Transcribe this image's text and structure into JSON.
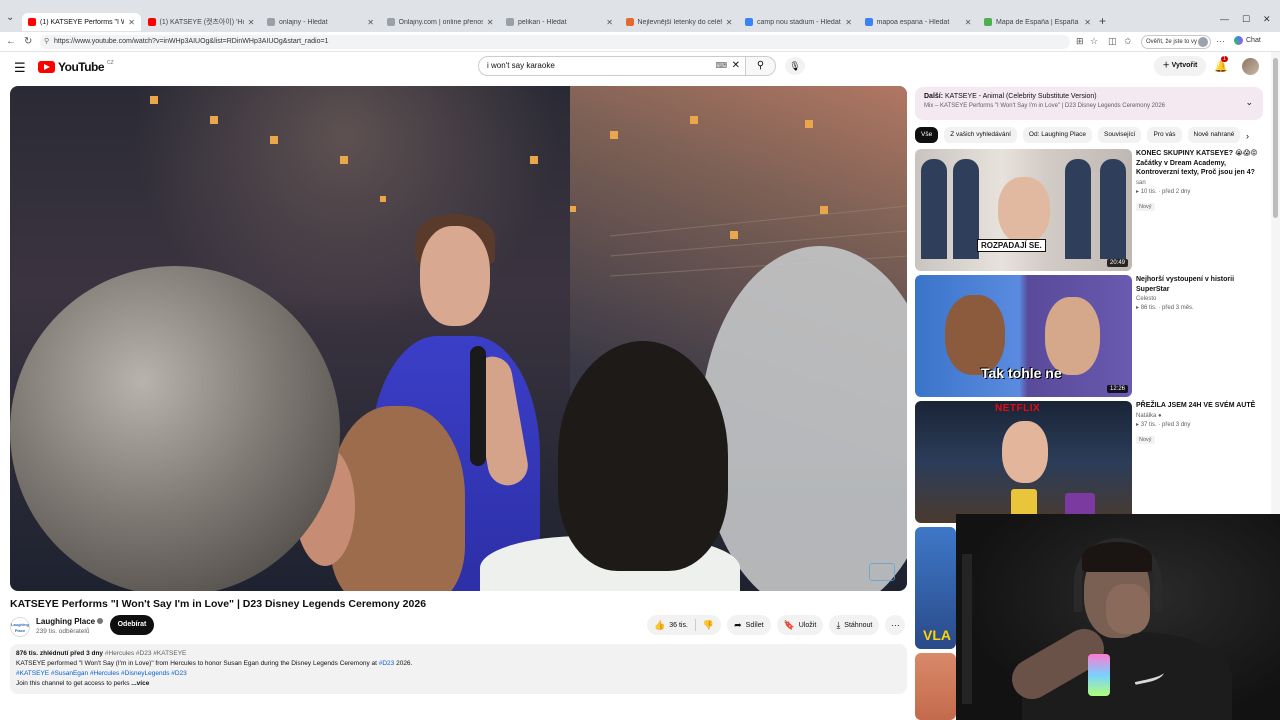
{
  "browser": {
    "tabs": [
      {
        "title": "(1) KATSEYE Performs \"I Won't",
        "favicon_color": "#ff0000",
        "active": true
      },
      {
        "title": "(1) KATSEYE (캣츠아이) 'Hootie Fri",
        "favicon_color": "#ff0000",
        "active": false
      },
      {
        "title": "onlajny - Hledat",
        "favicon_color": "#9aa0a6",
        "active": false
      },
      {
        "title": "Onlajny.com | online přenosy spo",
        "favicon_color": "#9aa0a6",
        "active": false
      },
      {
        "title": "pelikan - Hledat",
        "favicon_color": "#9aa0a6",
        "active": false
      },
      {
        "title": "Nejlevnější letenky do celého svět",
        "favicon_color": "#e36a2c",
        "active": false
      },
      {
        "title": "camp nou stadium - Hledat",
        "favicon_color": "#3b82f6",
        "active": false
      },
      {
        "title": "mapoa espana - Hledat",
        "favicon_color": "#3b82f6",
        "active": false
      },
      {
        "title": "Mapa de España | España Mapas",
        "favicon_color": "#4caf50",
        "active": false
      }
    ],
    "url": "https://www.youtube.com/watch?v=inWHp3AIUOg&list=RDinWHp3AIUOg&start_radio=1",
    "verify_label": "Ověřit, že jste to vy",
    "chat_label": "Chat"
  },
  "header": {
    "logo_text": "YouTube",
    "logo_country": "CZ",
    "search_value": "i won't say karaoke",
    "create_label": "Vytvořit",
    "notifications": "1"
  },
  "video": {
    "title": "KATSEYE Performs \"I Won't Say I'm in Love\" | D23 Disney Legends Ceremony 2026",
    "channel": {
      "name": "Laughing Place",
      "subscribers": "239 tis. odběratelů",
      "avatar_text": "Laughing Place",
      "subscribe_label": "Odebírat"
    },
    "actions": {
      "likes": "36 tis.",
      "share": "Sdílet",
      "save": "Uložit",
      "download": "Stáhnout"
    },
    "description": {
      "views_date": "876 tis. zhlédnutí  před 3 dny",
      "hashtags_top": "#Hercules #D23 #KATSEYE",
      "line1_pre": "KATSEYE performed \"I Won't Say (I'm in Love)\" from Hercules to honor Susan Egan during the Disney Legends Ceremony at ",
      "line1_tag": "#D23",
      "line1_post": " 2026.",
      "line2_tags": "#KATSEYE #SusanEgan #Hercules #DisneyLegends #D23",
      "line3": "Join this channel to get access to perks",
      "more_label": "...více"
    }
  },
  "sidebar": {
    "mix": {
      "next_label": "Další:",
      "next_title": "KATSEYE - Animal (Celebrity Substitute Version)",
      "subtitle": "Mix – KATSEYE Performs \"I Won't Say I'm in Love\" | D23 Disney Legends Ceremony 2026"
    },
    "chips": [
      "Vše",
      "Z vašich vyhledávání",
      "Od: Laughing Place",
      "Související",
      "Pro vás",
      "Nově nahrané"
    ],
    "recommendations": [
      {
        "title": "KONEC SKUPINY KATSEYE? 😭😱😡 Začátky v Dream Academy, Kontroverzní texty, Proč jsou jen 4?",
        "channel": "san",
        "meta": "10 tis. · před 2 dny",
        "badge": "Nový",
        "duration": "20:49",
        "thumb_caption": "ROZPADAJÍ SE."
      },
      {
        "title": "Nejhorší vystoupení v historii SuperStar",
        "channel": "Celesto",
        "meta": "86 tis. · před 3 měs.",
        "badge": "",
        "duration": "12:26",
        "thumb_caption": "Tak tohle ne"
      },
      {
        "title": "PŘEŽILA JSEM 24H VE SVÉM AUTĚ",
        "channel": "Natálka",
        "meta": "37 tis. · před 3 dny",
        "badge": "Nový",
        "duration": "",
        "thumb_caption": "NETFLIX"
      },
      {
        "title": "",
        "channel": "",
        "meta": "",
        "badge": "",
        "duration": "",
        "thumb_caption": "VLA"
      }
    ]
  },
  "colors": {
    "youtube_red": "#ff0000",
    "subscribe_bg": "#0f0f0f",
    "mix_bg": "#f4e9f0",
    "link_blue": "#065fd4"
  }
}
